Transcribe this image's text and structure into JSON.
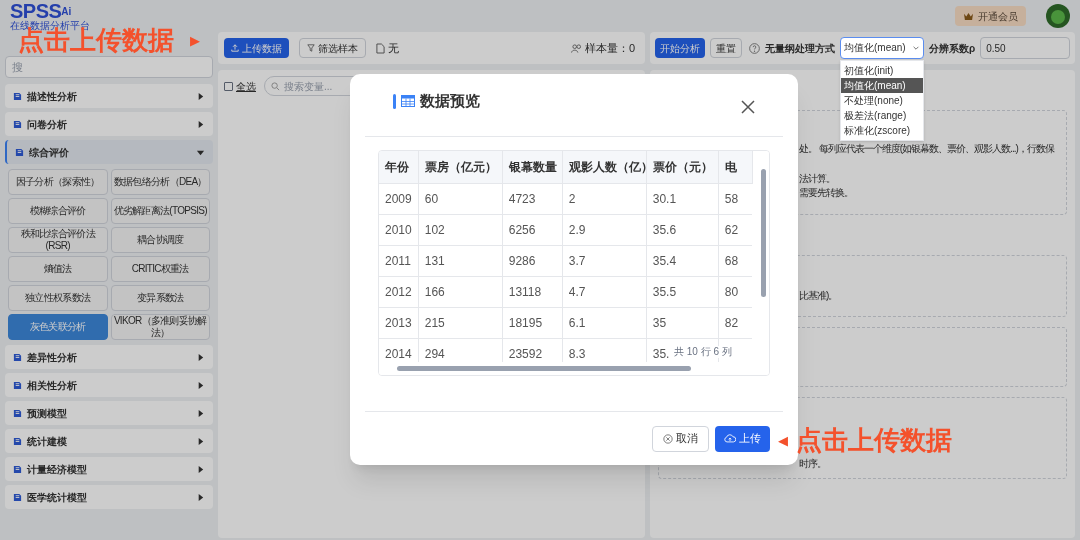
{
  "header": {
    "logo": "SPSS",
    "logo_suffix": "Ai",
    "tagline": "在线数据分析平台",
    "member_button": "开通会员"
  },
  "sidebar": {
    "search_placeholder": "搜",
    "categories": [
      {
        "label": "描述性分析",
        "expanded": false
      },
      {
        "label": "问卷分析",
        "expanded": false
      },
      {
        "label": "综合评价",
        "expanded": true,
        "children": [
          {
            "label": "因子分析（探索性）",
            "selected": false
          },
          {
            "label": "数据包络分析（DEA）",
            "selected": false
          },
          {
            "label": "模糊综合评价",
            "selected": false
          },
          {
            "label": "优劣解距离法(TOPSIS)",
            "selected": false
          },
          {
            "label": "秩和比综合评价法(RSR)",
            "selected": false
          },
          {
            "label": "耦合协调度",
            "selected": false
          },
          {
            "label": "熵值法",
            "selected": false
          },
          {
            "label": "CRITIC权重法",
            "selected": false
          },
          {
            "label": "独立性权系数法",
            "selected": false
          },
          {
            "label": "变异系数法",
            "selected": false
          },
          {
            "label": "灰色关联分析",
            "selected": true
          },
          {
            "label": "VIKOR（多准则妥协解法）",
            "selected": false
          }
        ]
      },
      {
        "label": "差异性分析",
        "expanded": false
      },
      {
        "label": "相关性分析",
        "expanded": false
      },
      {
        "label": "预测模型",
        "expanded": false
      },
      {
        "label": "统计建模",
        "expanded": false
      },
      {
        "label": "计量经济模型",
        "expanded": false
      },
      {
        "label": "医学统计模型",
        "expanded": false
      }
    ]
  },
  "data_toolbar": {
    "upload": "上传数据",
    "filter": "筛选样本",
    "file": "无",
    "sample_size": "样本量：0"
  },
  "variables": {
    "select_all": "全选",
    "select_all_checked": false,
    "search_placeholder": "搜索变量..."
  },
  "analysis_toolbar": {
    "start": "开始分析",
    "reset": "重置",
    "method_label": "无量纲处理方式",
    "method_value": "均值化(mean)",
    "method_options": [
      {
        "label": "初值化(init)",
        "selected": false
      },
      {
        "label": "均值化(mean)",
        "selected": true
      },
      {
        "label": "不处理(none)",
        "selected": false
      },
      {
        "label": "极差法(range)",
        "selected": false
      },
      {
        "label": "标准化(zscore)",
        "selected": false
      }
    ],
    "coef_label": "分辨系数ρ",
    "coef_value": "0.50"
  },
  "description_boxes": [
    {
      "lines": [
        "处。 每列应代表一个维度(如银幕数、票价、观影人数...)，行数保",
        "法计算。",
        "需要先转换。"
      ]
    },
    {
      "lines": [
        "比基准)。"
      ]
    },
    {
      "lines": [
        "时序。"
      ]
    }
  ],
  "modal": {
    "title": "数据预览",
    "columns": [
      "年份",
      "票房（亿元）",
      "银幕数量",
      "观影人数（亿）",
      "票价（元）",
      "电"
    ],
    "rows": [
      [
        "2009",
        "60",
        "4723",
        "2",
        "30.1",
        "58"
      ],
      [
        "2010",
        "102",
        "6256",
        "2.9",
        "35.6",
        "62"
      ],
      [
        "2011",
        "131",
        "9286",
        "3.7",
        "35.4",
        "68"
      ],
      [
        "2012",
        "166",
        "13118",
        "4.7",
        "35.5",
        "80"
      ],
      [
        "2013",
        "215",
        "18195",
        "6.1",
        "35",
        "82"
      ],
      [
        "2014",
        "294",
        "23592",
        "8.3",
        "35."
      ]
    ],
    "summary": "共 10 行 6 列",
    "cancel": "取消",
    "upload": "上传"
  },
  "annotations": [
    {
      "kind": "trailing",
      "text": "点击上传数据",
      "arrow": "▶"
    },
    {
      "kind": "leading",
      "text": "点击上传数据",
      "arrow": "◀"
    }
  ]
}
